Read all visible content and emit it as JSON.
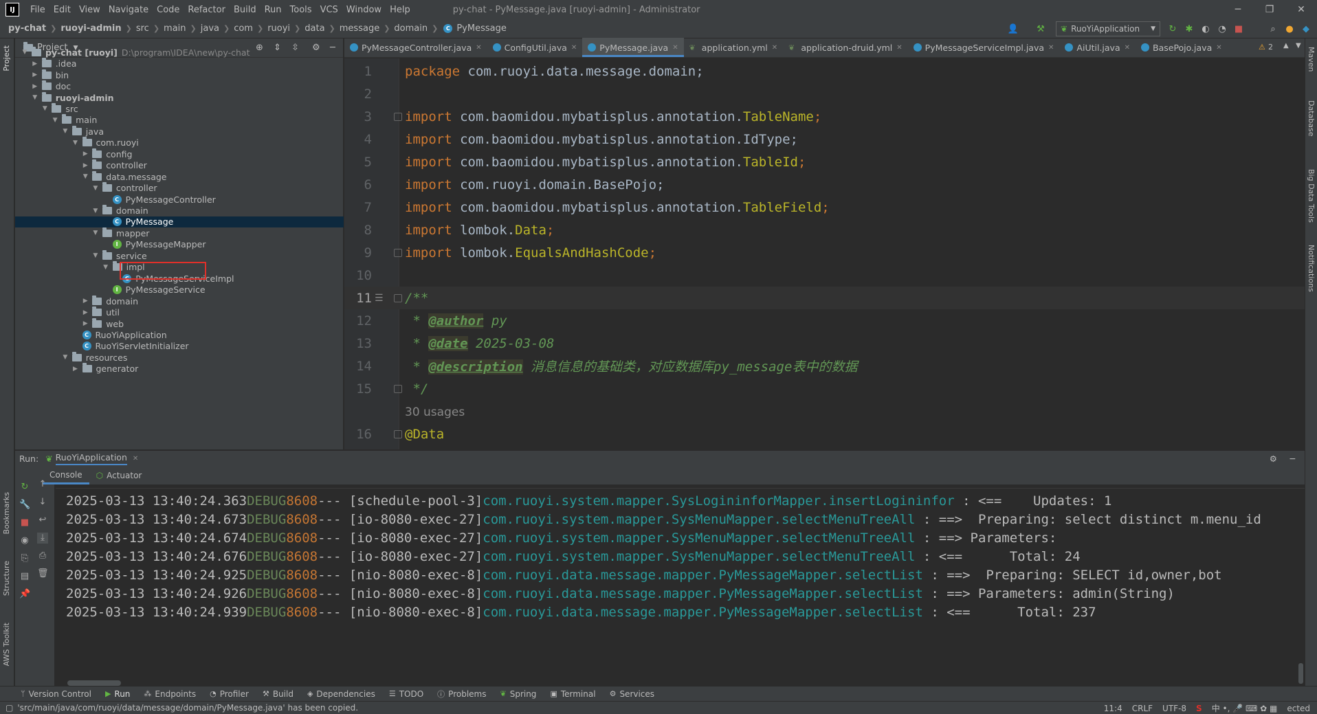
{
  "window": {
    "app_logo": "IJ",
    "menu": [
      "File",
      "Edit",
      "View",
      "Navigate",
      "Code",
      "Refactor",
      "Build",
      "Run",
      "Tools",
      "VCS",
      "Window",
      "Help"
    ],
    "title": "py-chat - PyMessage.java [ruoyi-admin] - Administrator"
  },
  "breadcrumbs": [
    "py-chat",
    "ruoyi-admin",
    "src",
    "main",
    "java",
    "com",
    "ruoyi",
    "data",
    "message",
    "domain",
    "PyMessage"
  ],
  "toolbar": {
    "run_config": "RuoYiApplication"
  },
  "project": {
    "header": "Project",
    "tree": [
      {
        "label": "py-chat [ruoyi]",
        "path": "D:\\program\\IDEA\\new\\py-chat"
      },
      {
        "label": ".idea"
      },
      {
        "label": "bin"
      },
      {
        "label": "doc"
      },
      {
        "label": "ruoyi-admin"
      },
      {
        "label": "src"
      },
      {
        "label": "main"
      },
      {
        "label": "java"
      },
      {
        "label": "com.ruoyi"
      },
      {
        "label": "config"
      },
      {
        "label": "controller"
      },
      {
        "label": "data.message"
      },
      {
        "label": "controller"
      },
      {
        "label": "PyMessageController"
      },
      {
        "label": "domain"
      },
      {
        "label": "PyMessage"
      },
      {
        "label": "mapper"
      },
      {
        "label": "PyMessageMapper"
      },
      {
        "label": "service"
      },
      {
        "label": "impl"
      },
      {
        "label": "PyMessageServiceImpl"
      },
      {
        "label": "PyMessageService"
      },
      {
        "label": "domain"
      },
      {
        "label": "util"
      },
      {
        "label": "web"
      },
      {
        "label": "RuoYiApplication"
      },
      {
        "label": "RuoYiServletInitializer"
      },
      {
        "label": "resources"
      },
      {
        "label": "generator"
      }
    ]
  },
  "editor": {
    "tabs": [
      "PyMessageController.java",
      "ConfigUtil.java",
      "PyMessage.java",
      "application.yml",
      "application-druid.yml",
      "PyMessageServiceImpl.java",
      "AiUtil.java",
      "BasePojo.java"
    ],
    "warnings": "2",
    "line_numbers": [
      "1",
      "2",
      "3",
      "4",
      "5",
      "6",
      "7",
      "8",
      "9",
      "10",
      "11",
      "12",
      "13",
      "14",
      "15",
      "16"
    ],
    "code": {
      "l1_kw": "package",
      "l1_rest": " com.ruoyi.data.message.domain;",
      "l3_pkg": " com.baomidou.mybatisplus.annotation.",
      "l3_cls": "TableName",
      "l4_pkg": " com.baomidou.mybatisplus.annotation.IdType;",
      "l5_pkg": " com.baomidou.mybatisplus.annotation.",
      "l5_cls": "TableId",
      "l6_pkg": " com.ruoyi.domain.BasePojo;",
      "l7_pkg": " com.baomidou.mybatisplus.annotation.",
      "l7_cls": "TableField",
      "l8_pkg": " lombok.",
      "l8_cls": "Data",
      "l9_pkg": " lombok.",
      "l9_cls": "EqualsAndHashCode",
      "import_kw": "import",
      "semi": ";",
      "l11": "/**",
      "l12_tag": "@author",
      "l12_val": " py",
      "l13_tag": "@date",
      "l13_val": " 2025-03-08",
      "l14_tag": "@description",
      "l14_val": " 消息信息的基础类，对应数据库py_message表中的数据",
      "l15": " */",
      "star": " * ",
      "usages": "30 usages",
      "l16": "@Data"
    }
  },
  "run": {
    "label": "Run:",
    "config": "RuoYiApplication",
    "subtabs": [
      "Console",
      "Actuator"
    ],
    "logs": [
      {
        "ts": "2025-03-13 13:40:24.363",
        "lvl": "DEBUG",
        "pid": "8608",
        "thread": "--- [schedule-pool-3]",
        "logger": "com.ruoyi.system.mapper.SysLogininforMapper.insertLogininfor",
        "msg": " : <==    Updates: 1"
      },
      {
        "ts": "2025-03-13 13:40:24.673",
        "lvl": "DEBUG",
        "pid": "8608",
        "thread": "--- [io-8080-exec-27]",
        "logger": "com.ruoyi.system.mapper.SysMenuMapper.selectMenuTreeAll",
        "msg": " : ==>  Preparing: select distinct m.menu_id"
      },
      {
        "ts": "2025-03-13 13:40:24.674",
        "lvl": "DEBUG",
        "pid": "8608",
        "thread": "--- [io-8080-exec-27]",
        "logger": "com.ruoyi.system.mapper.SysMenuMapper.selectMenuTreeAll",
        "msg": " : ==> Parameters: "
      },
      {
        "ts": "2025-03-13 13:40:24.676",
        "lvl": "DEBUG",
        "pid": "8608",
        "thread": "--- [io-8080-exec-27]",
        "logger": "com.ruoyi.system.mapper.SysMenuMapper.selectMenuTreeAll",
        "msg": " : <==      Total: 24"
      },
      {
        "ts": "2025-03-13 13:40:24.925",
        "lvl": "DEBUG",
        "pid": "8608",
        "thread": "--- [nio-8080-exec-8]",
        "logger": "com.ruoyi.data.message.mapper.PyMessageMapper.selectList",
        "msg": " : ==>  Preparing: SELECT id,owner,bot"
      },
      {
        "ts": "2025-03-13 13:40:24.926",
        "lvl": "DEBUG",
        "pid": "8608",
        "thread": "--- [nio-8080-exec-8]",
        "logger": "com.ruoyi.data.message.mapper.PyMessageMapper.selectList",
        "msg": " : ==> Parameters: admin(String)"
      },
      {
        "ts": "2025-03-13 13:40:24.939",
        "lvl": "DEBUG",
        "pid": "8608",
        "thread": "--- [nio-8080-exec-8]",
        "logger": "com.ruoyi.data.message.mapper.PyMessageMapper.selectList",
        "msg": " : <==      Total: 237"
      }
    ]
  },
  "bottom_tools": [
    "Version Control",
    "Run",
    "Endpoints",
    "Profiler",
    "Build",
    "Dependencies",
    "TODO",
    "Problems",
    "Spring",
    "Terminal",
    "Services"
  ],
  "status": {
    "message": "'src/main/java/com/ruoyi/data/message/domain/PyMessage.java' has been copied.",
    "position": "11:4",
    "line_sep": "CRLF",
    "encoding": "UTF-8",
    "tail": "ected"
  },
  "side_stripes": {
    "left": [
      "Project",
      "Bookmarks",
      "Structure",
      "AWS Toolkit"
    ],
    "right": [
      "Maven",
      "Database",
      "Big Data Tools",
      "Notifications"
    ]
  },
  "colors": {
    "accent": "#4a88c7",
    "selection": "#0d293e",
    "highlight_box": "#e0302a"
  }
}
